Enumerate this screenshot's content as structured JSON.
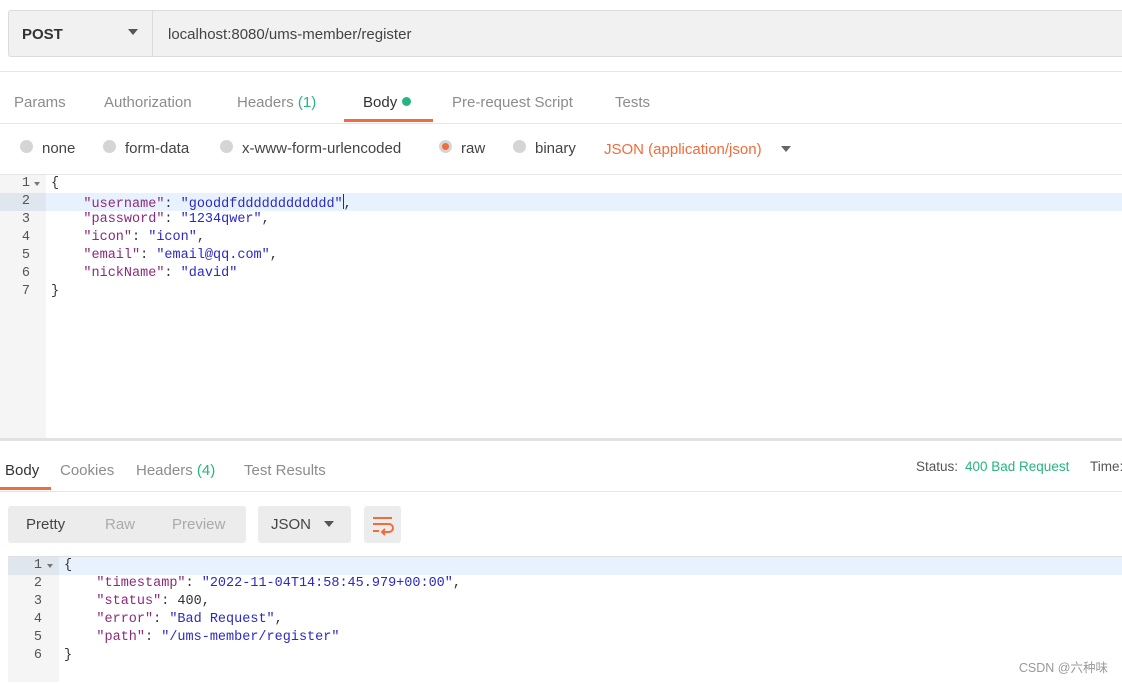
{
  "request": {
    "method": "POST",
    "url": "localhost:8080/ums-member/register",
    "tabs": [
      {
        "label": "Params"
      },
      {
        "label": "Authorization"
      },
      {
        "label": "Headers ",
        "count": "(1)"
      },
      {
        "label": "Body"
      },
      {
        "label": "Pre-request Script"
      },
      {
        "label": "Tests"
      }
    ],
    "body_types": [
      "none",
      "form-data",
      "x-www-form-urlencoded",
      "raw",
      "binary"
    ],
    "selected_body_type": "raw",
    "content_type": "JSON (application/json)",
    "line_numbers": [
      "1",
      "2",
      "3",
      "4",
      "5",
      "6",
      "7"
    ],
    "code": {
      "open": "{",
      "username_key": "\"username\"",
      "username_val": "\"gooddfdddddddddddd\"",
      "password_key": "\"password\"",
      "password_val": "\"1234qwer\"",
      "icon_key": "\"icon\"",
      "icon_val": "\"icon\"",
      "email_key": "\"email\"",
      "email_val": "\"email@qq.com\"",
      "nick_key": "\"nickName\"",
      "nick_val": "\"david\"",
      "close": "}"
    }
  },
  "response": {
    "tabs": [
      {
        "label": "Body"
      },
      {
        "label": "Cookies"
      },
      {
        "label": "Headers ",
        "count": "(4)"
      },
      {
        "label": "Test Results"
      }
    ],
    "status_label": "Status:",
    "status_value": "400 Bad Request",
    "time_label": "Time:",
    "view_modes": [
      "Pretty",
      "Raw",
      "Preview"
    ],
    "format": "JSON",
    "line_numbers": [
      "1",
      "2",
      "3",
      "4",
      "5",
      "6"
    ],
    "code": {
      "open": "{",
      "timestamp_key": "\"timestamp\"",
      "timestamp_val": "\"2022-11-04T14:58:45.979+00:00\"",
      "status_key": "\"status\"",
      "status_val": "400",
      "error_key": "\"error\"",
      "error_val": "\"Bad Request\"",
      "path_key": "\"path\"",
      "path_val": "\"/ums-member/register\"",
      "close": "}"
    }
  },
  "watermark": "CSDN @六种味",
  "colors": {
    "accent": "#f26b3a",
    "success": "#26b47f",
    "string": "#2a2ac4",
    "key": "#8c2a7d"
  }
}
